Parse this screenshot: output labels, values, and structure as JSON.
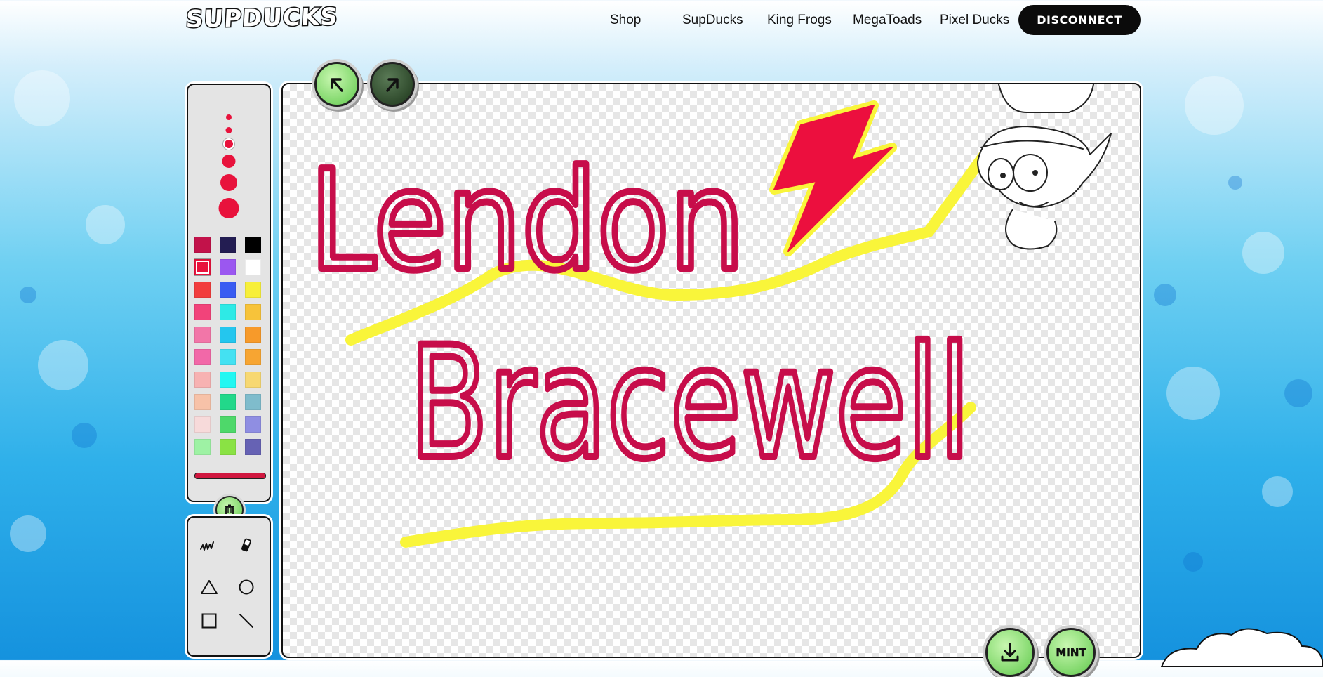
{
  "brand": {
    "logo_text": "SUPDUCKS"
  },
  "nav": {
    "links": [
      {
        "label": "Shop"
      },
      {
        "label": "SupDucks"
      },
      {
        "label": "King Frogs"
      },
      {
        "label": "MegaToads"
      },
      {
        "label": "Pixel Ducks"
      }
    ],
    "disconnect_label": "DISCONNECT"
  },
  "palette": {
    "selected_color": "#d0173f",
    "colors": [
      [
        "#c2124a",
        "#231d52",
        "#000000"
      ],
      [
        "#e8123c",
        "#9b57f0",
        "#ffffff"
      ],
      [
        "#f23d3d",
        "#3a5cf2",
        "#f7ef3a"
      ],
      [
        "#f2437a",
        "#2eeae6",
        "#f7c33a"
      ],
      [
        "#f276a8",
        "#24c6ee",
        "#f79a2a"
      ],
      [
        "#f268a8",
        "#44e1f2",
        "#f7a532"
      ],
      [
        "#f7b2b2",
        "#22f7f2",
        "#f7d872"
      ],
      [
        "#f7c2a8",
        "#22d88a",
        "#7fbccc"
      ],
      [
        "#f7dada",
        "#4ed86a",
        "#8f8ee2"
      ],
      [
        "#9ef2a4",
        "#8ae244",
        "#6662b4"
      ]
    ],
    "brush_sizes": [
      "xs",
      "s",
      "m",
      "l",
      "xl",
      "xxl"
    ]
  },
  "tools": {
    "items": [
      {
        "icon": "brush-icon"
      },
      {
        "icon": "eraser-icon"
      },
      {
        "icon": "triangle-icon"
      },
      {
        "icon": "circle-icon"
      },
      {
        "icon": "square-icon"
      },
      {
        "icon": "line-icon"
      }
    ]
  },
  "canvas": {
    "drawing_text_line1": "Lendon",
    "drawing_text_line2": "Bracewell",
    "stroke_color": "#c70d4a",
    "highlight_color": "#f9f53a"
  },
  "actions": {
    "mint_label": "MINT",
    "download_icon": "download-icon",
    "undo_icon": "undo-icon",
    "redo_icon": "redo-icon",
    "trash_icon": "trash-icon"
  }
}
